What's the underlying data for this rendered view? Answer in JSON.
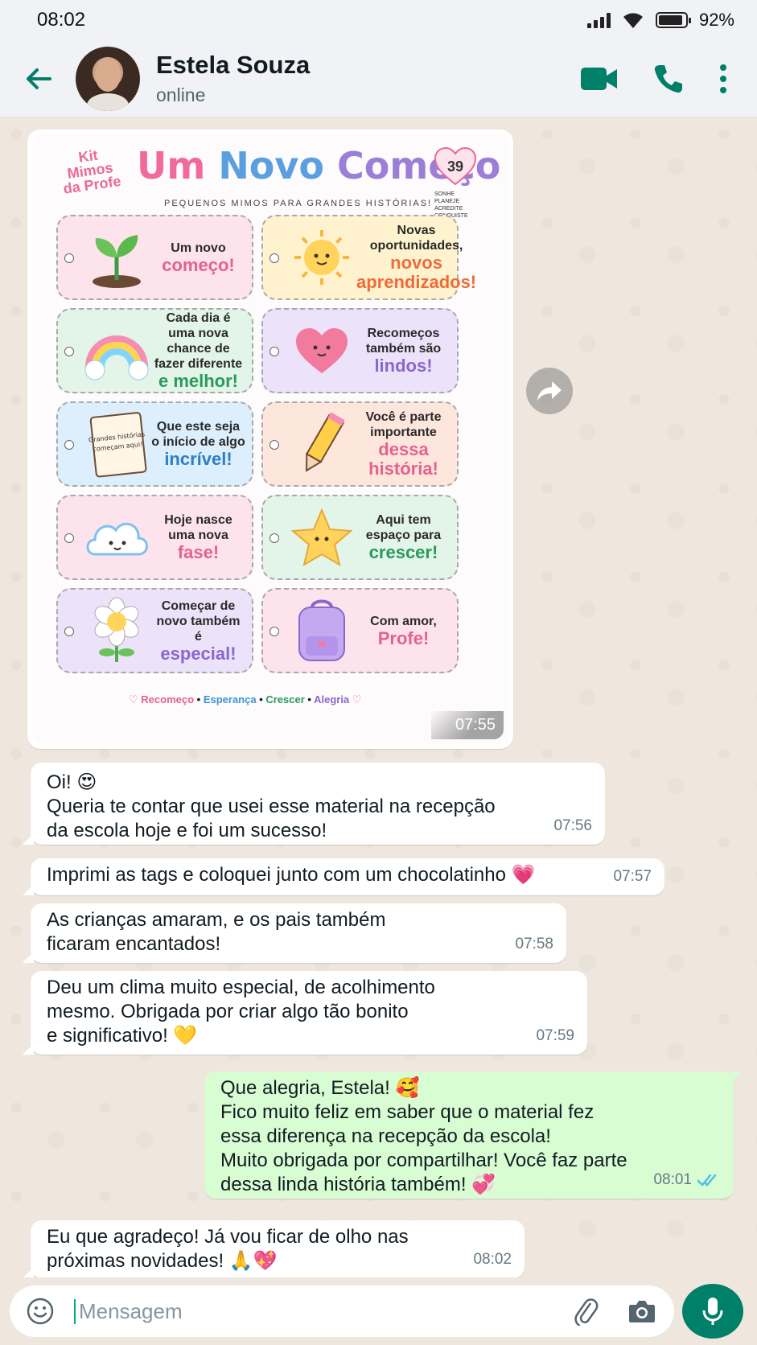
{
  "status_bar": {
    "time": "08:02",
    "battery": "92%",
    "battery_level": 0.92
  },
  "header": {
    "name": "Estela Souza",
    "status": "online"
  },
  "image_message": {
    "kit_label": "Kit Mimos da Profe",
    "title_parts": [
      "Um",
      "Novo",
      "Começo"
    ],
    "subtitle": "PEQUENOS MIMOS PARA GRANDES HISTÓRIAS!",
    "number": "39",
    "badge_text": "SONHE PLANEJE ACREDITE CONQUISTE",
    "tags": [
      {
        "text": "Um novo",
        "highlight": "começo!",
        "color": "pink",
        "art": "sprout-icon"
      },
      {
        "text": "Novas oportunidades,",
        "highlight": "novos aprendizados!",
        "color": "yellow",
        "art": "sun-icon"
      },
      {
        "text": "Cada dia é uma nova chance de fazer diferente",
        "highlight": "e melhor!",
        "color": "green",
        "art": "rainbow-icon"
      },
      {
        "text": "Recomeços também são",
        "highlight": "lindos!",
        "color": "purple",
        "art": "heart-icon"
      },
      {
        "text": "Que este seja o início de algo",
        "highlight": "incrível!",
        "color": "blue",
        "art": "notebook-icon"
      },
      {
        "text": "Você é parte importante",
        "highlight": "dessa história!",
        "color": "peach",
        "art": "pencil-icon"
      },
      {
        "text": "Hoje nasce uma nova",
        "highlight": "fase!",
        "color": "pink",
        "art": "cloud-icon"
      },
      {
        "text": "Aqui tem espaço para",
        "highlight": "crescer!",
        "color": "green",
        "art": "star-icon"
      },
      {
        "text": "Começar de novo também é",
        "highlight": "especial!",
        "color": "purple",
        "art": "flower-icon"
      },
      {
        "text": "Com amor,",
        "highlight": "Profe!",
        "color": "pink",
        "art": "backpack-icon"
      }
    ],
    "notebook_text": "Grandes histórias começam aqui!",
    "footer": [
      "Recomeço",
      "Esperança",
      "Crescer",
      "Alegria"
    ],
    "time": "07:55"
  },
  "messages": [
    {
      "dir": "in",
      "text": "Oi! 😍\nQueria te contar que usei esse material na recepção\nda escola hoje e foi um sucesso!",
      "time": "07:56"
    },
    {
      "dir": "in",
      "text": "Imprimi as tags e coloquei junto com um chocolatinho 💗",
      "time": "07:57"
    },
    {
      "dir": "in",
      "text": "As crianças amaram, e os pais também\nficaram encantados!",
      "time": "07:58"
    },
    {
      "dir": "in",
      "text": "Deu um clima muito especial, de acolhimento\nmesmo. Obrigada por criar algo tão bonito\ne significativo! 💛",
      "time": "07:59"
    },
    {
      "dir": "out",
      "text": "Que alegria, Estela! 🥰\nFico muito feliz em saber que o material fez\nessa diferença na recepção da escola!\nMuito obrigada por compartilhar! Você faz parte\ndessa linda história também! 💞",
      "time": "08:01"
    },
    {
      "dir": "in",
      "text": "Eu que agradeço! Já vou ficar de olho nas\npróximas novidades! 🙏💖",
      "time": "08:02"
    }
  ],
  "input": {
    "placeholder": "Mensagem"
  },
  "colors": {
    "accent": "#008069",
    "outgoing": "#d9fdd3",
    "incoming": "#ffffff",
    "tick": "#53bdeb"
  }
}
